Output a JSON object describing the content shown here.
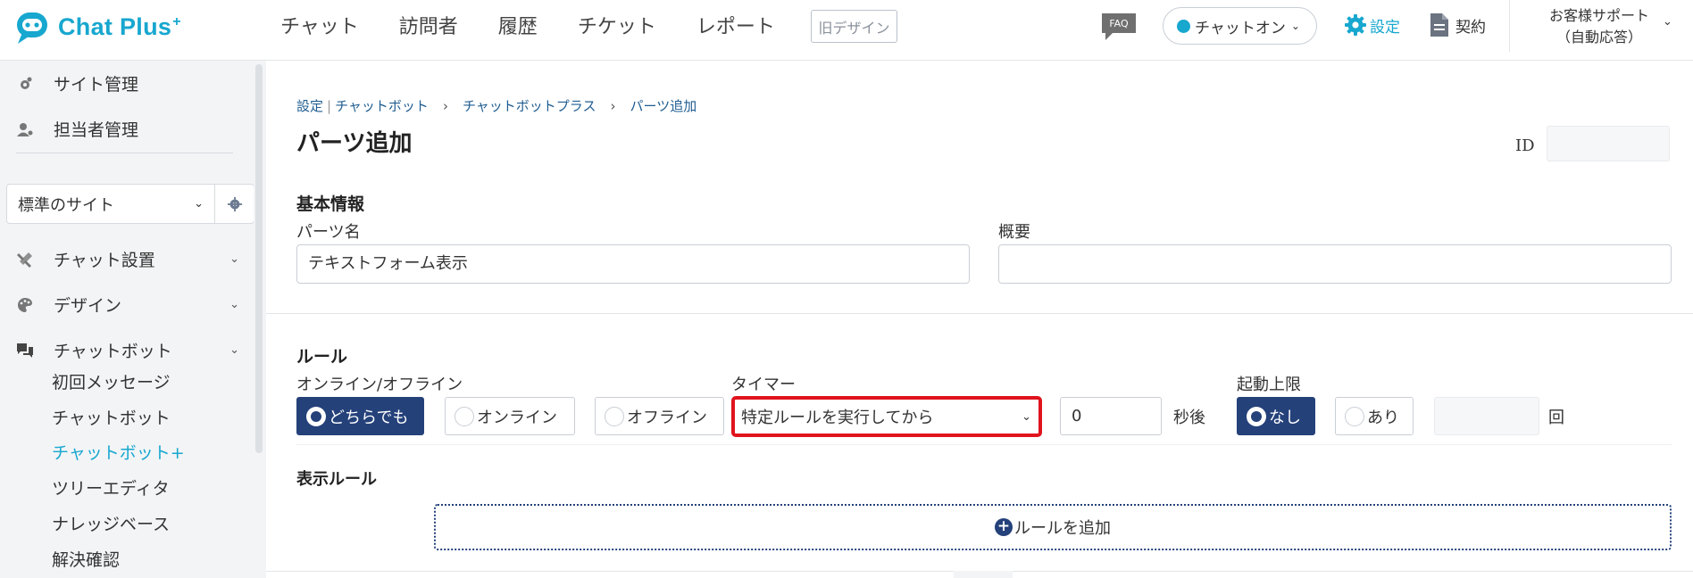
{
  "header": {
    "logo_text": "Chat Plus",
    "logo_plus": "+",
    "nav": [
      "チャット",
      "訪問者",
      "履歴",
      "チケット",
      "レポート"
    ],
    "old_design": "旧デザイン",
    "faq": "FAQ",
    "chat_status": "チャットオン",
    "settings": "設定",
    "contract": "契約",
    "support_line1": "お客様サポート",
    "support_line2": "（自動応答）",
    "brand_color": "#17a7cf"
  },
  "sidebar": {
    "site_admin": "サイト管理",
    "staff_admin": "担当者管理",
    "site_select": "標準のサイト",
    "chat_setup": "チャット設置",
    "design": "デザイン",
    "chatbot": "チャットボット",
    "sub_items": [
      "初回メッセージ",
      "チャットボット",
      "チャットボット+",
      "ツリーエディタ",
      "ナレッジベース",
      "解決確認"
    ],
    "active_sub": "チャットボット+"
  },
  "main": {
    "breadcrumb": {
      "settings": "設定",
      "chatbot": "チャットボット",
      "chatbot_plus": "チャットボットプラス",
      "current": "パーツ追加",
      "separator": "›"
    },
    "title": "パーツ追加",
    "id_label": "ID",
    "id_value": "",
    "basic_info": {
      "heading": "基本情報",
      "name_label": "パーツ名",
      "name_value": "テキストフォーム表示",
      "summary_label": "概要",
      "summary_value": ""
    },
    "rule": {
      "heading": "ルール",
      "online_label": "オンライン/オフライン",
      "options": [
        "どちらでも",
        "オンライン",
        "オフライン"
      ],
      "selected_option": "どちらでも",
      "timer_label": "タイマー",
      "timer_value": "特定ルールを実行してから",
      "seconds_value": "0",
      "seconds_unit": "秒後",
      "limit_label": "起動上限",
      "limit_options": [
        "なし",
        "あり"
      ],
      "limit_selected": "なし",
      "limit_count": "",
      "limit_unit": "回",
      "display_rule_heading": "表示ルール",
      "add_rule": "ルールを追加",
      "accent_color": "#24417a",
      "highlight_color": "#e0141d"
    }
  }
}
